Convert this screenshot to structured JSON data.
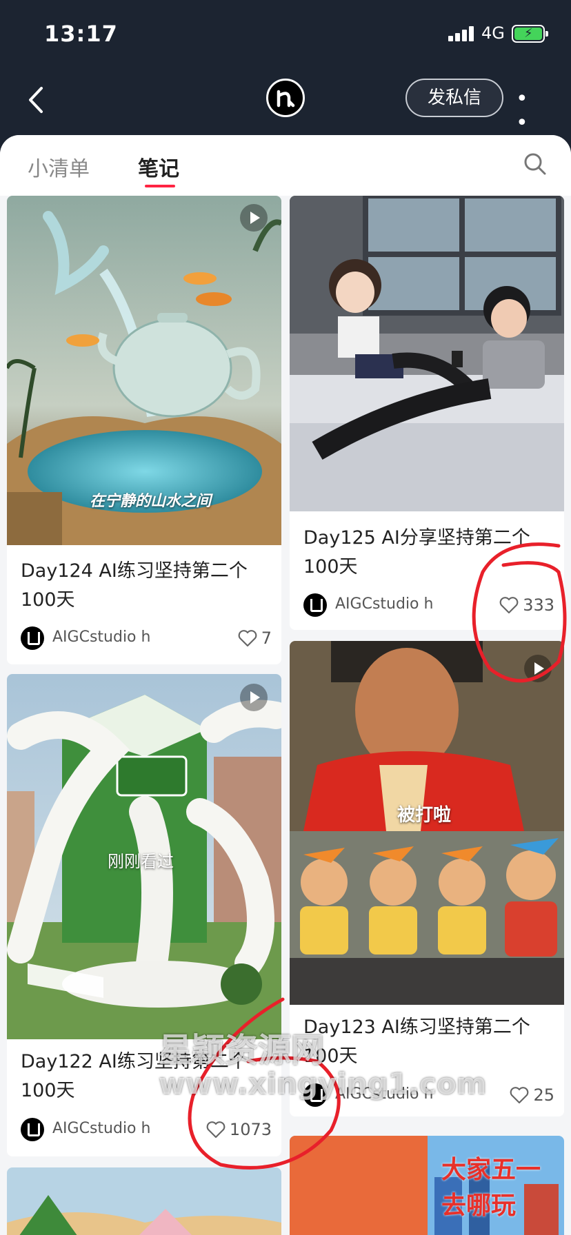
{
  "status": {
    "time": "13:17",
    "network": "4G"
  },
  "header": {
    "dm_label": "发私信"
  },
  "tabs": [
    {
      "label": "小清单",
      "active": false
    },
    {
      "label": "笔记",
      "active": true
    }
  ],
  "notes": [
    {
      "title_line1": "Day124 AI练习坚持第二个",
      "title_line2": "100天",
      "author": "AIGCstudio h",
      "likes": "7",
      "overlay": "在宁静的山水之间"
    },
    {
      "title_line1": "Day125 AI分享坚持第二个",
      "title_line2": "100天",
      "author": "AIGCstudio h",
      "likes": "333"
    },
    {
      "title_line1": "Day122 AI练习坚持第二个",
      "title_line2": "100天",
      "author": "AIGCstudio h",
      "likes": "1073",
      "overlay": "刚刚看过"
    },
    {
      "title_line1": "Day123 AI练习坚持第二个",
      "title_line2": "100天",
      "author": "AIGCstudio h",
      "likes": "25",
      "overlay": "被打啦"
    }
  ],
  "bottom_previews": {
    "left_text": "",
    "right_line1": "大家五一",
    "right_line2": "去哪玩"
  },
  "watermark": {
    "line1": "星颖资源网",
    "line2": "www.xingying1.com"
  },
  "colors": {
    "accent": "#ff2442",
    "header_bg": "#1c2431",
    "annotation": "#e8202a"
  }
}
